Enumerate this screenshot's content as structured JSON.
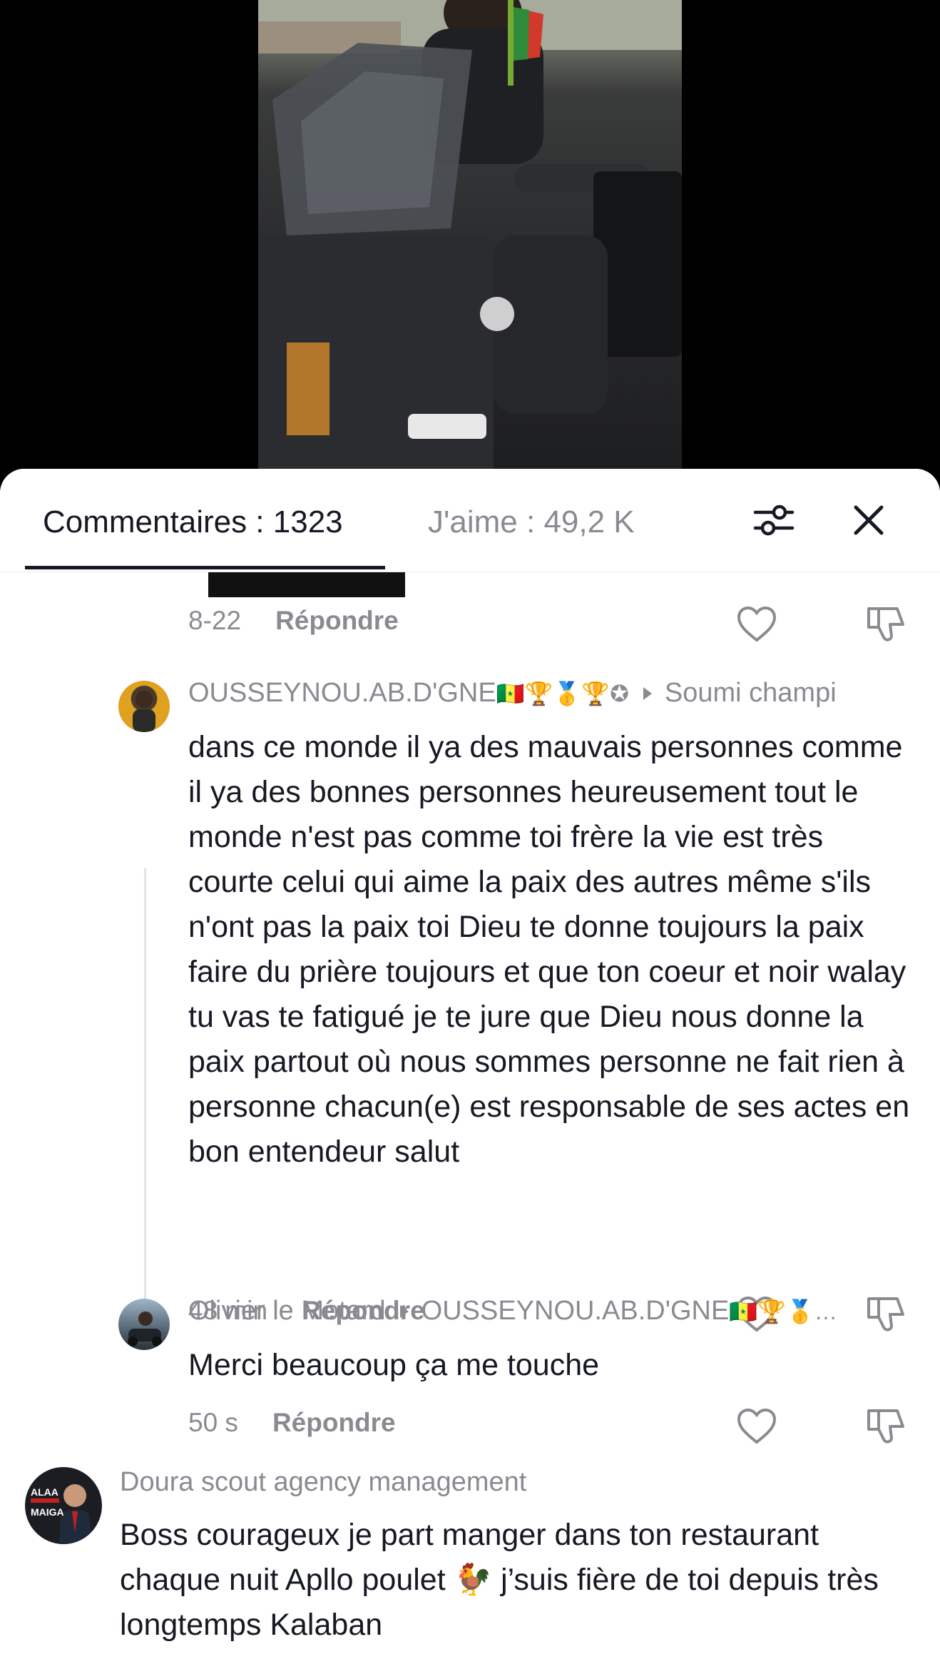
{
  "header": {
    "comments_label": "Commentaires : 1323",
    "likes_label": "J'aime : 49,2 K",
    "filter_icon": "filter-sliders-icon",
    "close_icon": "close-icon"
  },
  "comments": [
    {
      "time": "8-22",
      "reply_label": "Répondre"
    },
    {
      "username": "OUSSEYNOU.AB.D'GNE",
      "username_badges": "🇸🇳🏆🥇🏆✪",
      "reply_to": "Soumi champi",
      "text": "dans ce monde il ya des mauvais personnes comme il ya des bonnes personnes heureusement tout le monde n'est pas comme toi frère la vie est très courte celui qui aime la paix des autres même s'ils n'ont pas la paix toi Dieu te donne toujours la paix faire du prière toujours et que ton coeur et noir walay tu vas te fatigué je te jure que Dieu nous donne la paix partout où nous sommes personne ne fait rien à personne chacun(e) est responsable de ses actes en bon entendeur salut",
      "time": "48 min",
      "reply_label": "Répondre"
    },
    {
      "username": "Olivier le Motard",
      "reply_to": "OUSSEYNOU.AB.D'GNE",
      "reply_to_badges": "🇸🇳🏆🥇…",
      "text": "Merci beaucoup ça me touche",
      "time": "50 s",
      "reply_label": "Répondre"
    },
    {
      "username": "Doura scout agency management",
      "avatar_text_1": "ALAA",
      "avatar_text_2": "MAIGA",
      "text": "Boss courageux je part manger dans ton restaurant chaque nuit Apllo poulet 🐓 j’suis fière de toi depuis très longtemps Kalaban"
    }
  ],
  "colors": {
    "text_primary": "#161823",
    "text_secondary": "#8a8b91",
    "sheet_bg": "#ffffff",
    "video_bg": "#000000"
  }
}
